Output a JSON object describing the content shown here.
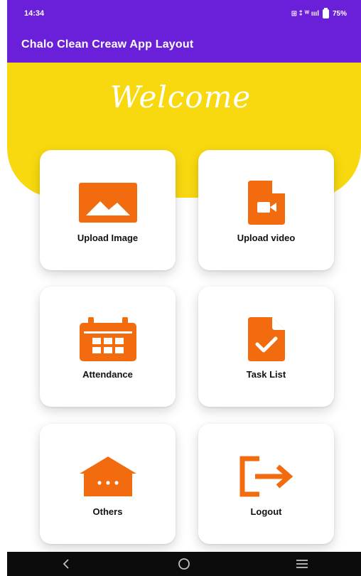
{
  "status_bar": {
    "time": "14:34",
    "indicators": "⊞ ⁑ ᵂ ıııl",
    "battery": "75%",
    "background": "#6a1fd8"
  },
  "app_bar": {
    "title": "Chalo Clean Creaw App Layout"
  },
  "banner": {
    "text": "Welcome",
    "color": "#f8d90f"
  },
  "accent_color": "#f26b0f",
  "cards": [
    {
      "label": "Upload Image",
      "icon": "image-icon"
    },
    {
      "label": "Upload video",
      "icon": "video-file-icon"
    },
    {
      "label": "Attendance",
      "icon": "calendar-icon"
    },
    {
      "label": "Task List",
      "icon": "task-file-icon"
    },
    {
      "label": "Others",
      "icon": "house-icon"
    },
    {
      "label": "Logout",
      "icon": "logout-icon"
    }
  ],
  "nav_bar": {
    "back": "back-icon",
    "home": "home-icon",
    "recents": "recents-icon"
  }
}
